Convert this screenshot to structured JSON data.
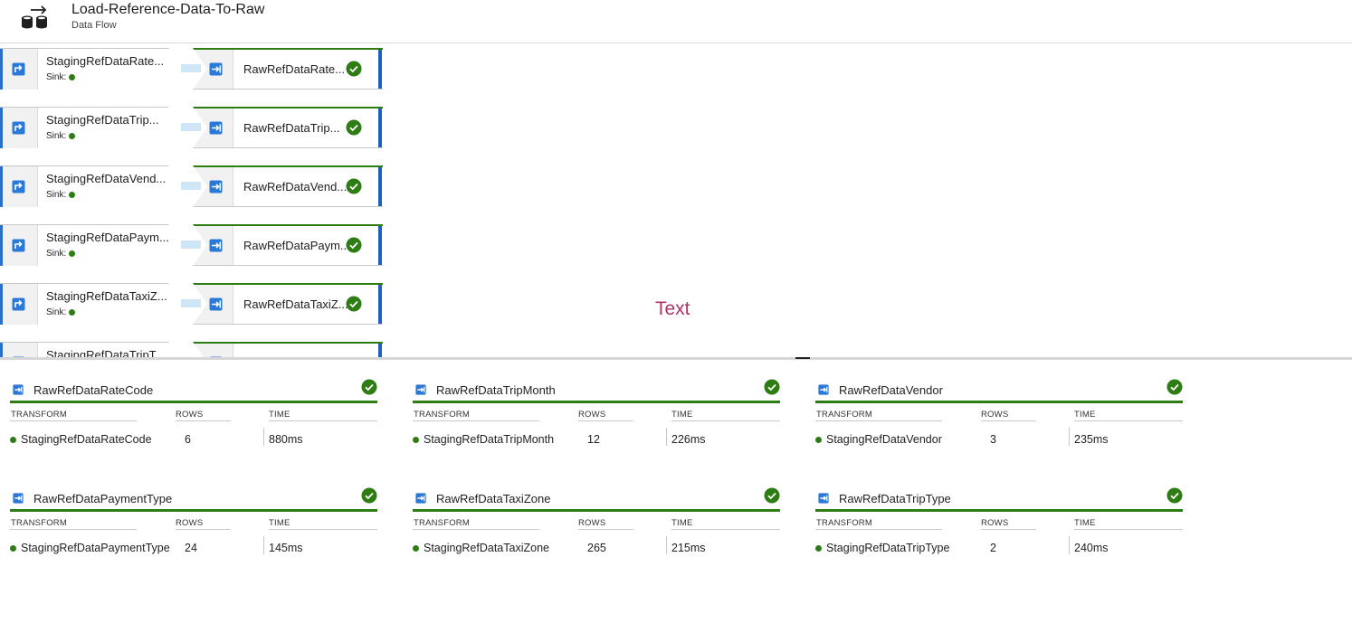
{
  "header": {
    "title": "Load-Reference-Data-To-Raw",
    "subtitle": "Data Flow",
    "icon": "dataflow-icon"
  },
  "canvas": {
    "annotation": "Text",
    "sink_label": "Sink:",
    "pipelines": [
      {
        "source": "StagingRefDataRate...",
        "sink": "RawRefDataRate..."
      },
      {
        "source": "StagingRefDataTrip...",
        "sink": "RawRefDataTrip..."
      },
      {
        "source": "StagingRefDataVend...",
        "sink": "RawRefDataVend..."
      },
      {
        "source": "StagingRefDataPaym...",
        "sink": "RawRefDataPaym..."
      },
      {
        "source": "StagingRefDataTaxiZ...",
        "sink": "RawRefDataTaxiZ..."
      },
      {
        "source": "StagingRefDataTripT",
        "sink": ""
      }
    ]
  },
  "stats": {
    "columns": {
      "transform": "TRANSFORM",
      "rows": "ROWS",
      "time": "TIME"
    },
    "cards": [
      {
        "name": "RawRefDataRateCode",
        "transform": "StagingRefDataRateCode",
        "rows": "6",
        "time": "880ms"
      },
      {
        "name": "RawRefDataTripMonth",
        "transform": "StagingRefDataTripMonth",
        "rows": "12",
        "time": "226ms"
      },
      {
        "name": "RawRefDataVendor",
        "transform": "StagingRefDataVendor",
        "rows": "3",
        "time": "235ms"
      },
      {
        "name": "RawRefDataPaymentType",
        "transform": "StagingRefDataPaymentType",
        "rows": "24",
        "time": "145ms"
      },
      {
        "name": "RawRefDataTaxiZone",
        "transform": "StagingRefDataTaxiZone",
        "rows": "265",
        "time": "215ms"
      },
      {
        "name": "RawRefDataTripType",
        "transform": "StagingRefDataTripType",
        "rows": "2",
        "time": "240ms"
      }
    ]
  },
  "colors": {
    "success": "#2e7d14",
    "accent_blue": "#1f5fbf",
    "annotation": "#b0336a"
  }
}
